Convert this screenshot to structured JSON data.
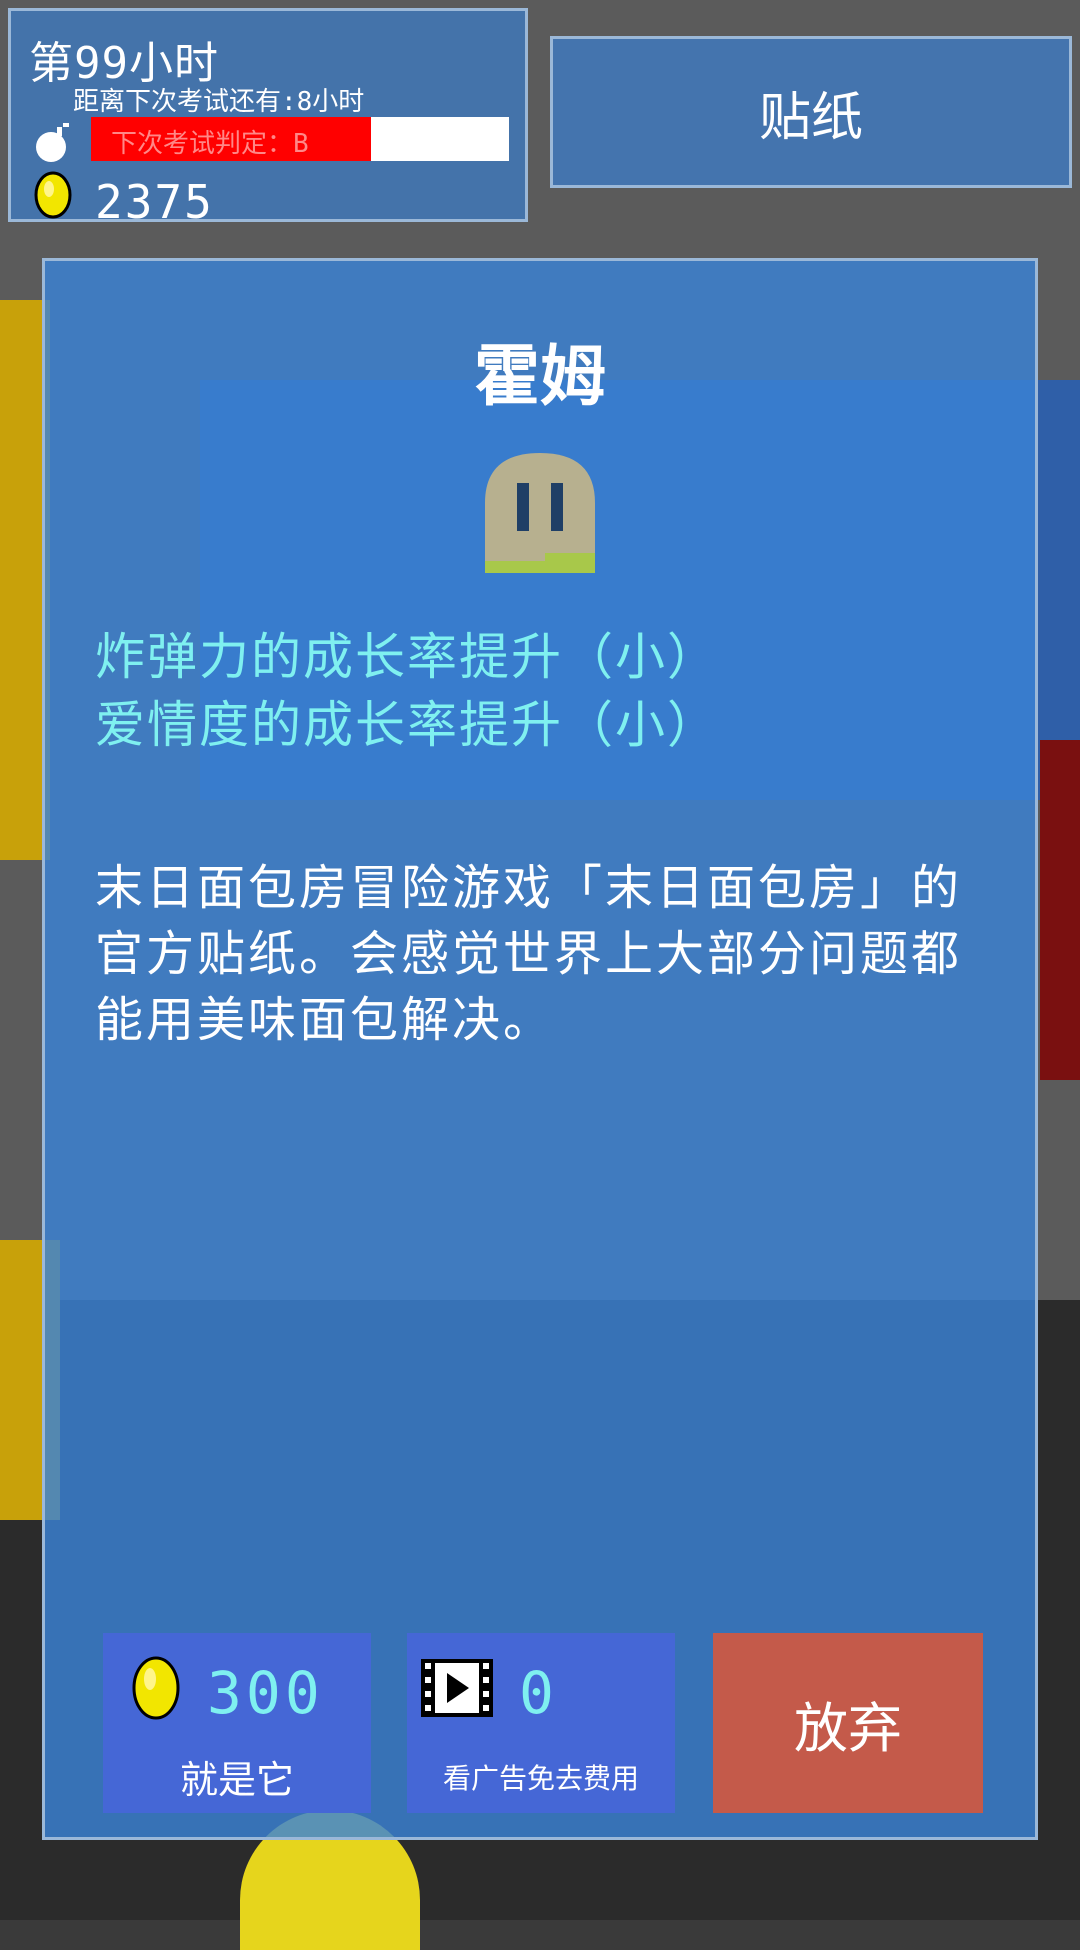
{
  "hud": {
    "hour_label": "第99小时",
    "next_exam_label": "距离下次考试还有:8小时",
    "exam_grade_label": "下次考试判定：B",
    "exam_progress": 0.67,
    "coins": "2375"
  },
  "tab": {
    "sticker_label": "贴纸"
  },
  "dialog": {
    "title": "霍姆",
    "effects": [
      "炸弹力的成长率提升（小）",
      "爱情度的成长率提升（小）"
    ],
    "description": "末日面包房冒险游戏「末日面包房」的官方贴纸。会感觉世界上大部分问题都能用美味面包解决。",
    "buy": {
      "price": "300",
      "label": "就是它"
    },
    "watch_ad": {
      "count": "0",
      "label": "看广告免去费用"
    },
    "quit_label": "放弃"
  },
  "colors": {
    "panel": "#3a82d6",
    "button_blue": "#4567d6",
    "button_red": "#c45a4a",
    "effect_text": "#7ff0f0",
    "exam_bar_fill": "#ff0000"
  },
  "icons": [
    "bomb-icon",
    "coin-icon",
    "film-play-icon",
    "sticker-slime-icon"
  ]
}
